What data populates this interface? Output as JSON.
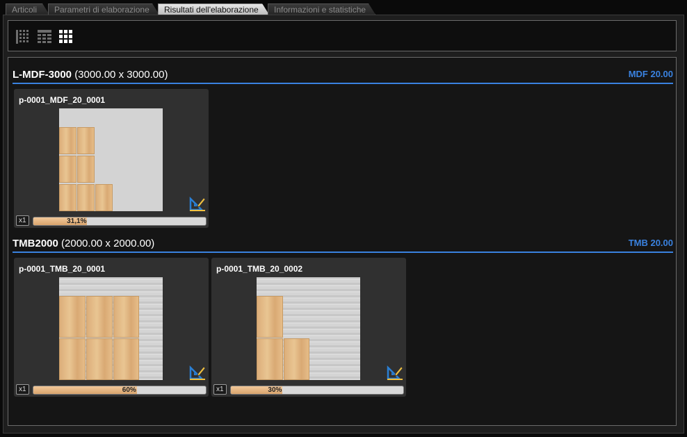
{
  "tabs": [
    {
      "label": "Articoli",
      "active": false
    },
    {
      "label": "Parametri di elaborazione",
      "active": false
    },
    {
      "label": "Risultati dell'elaborazione",
      "active": true
    },
    {
      "label": "Informazioni e statistiche",
      "active": false
    }
  ],
  "toolbar": {
    "views": [
      "list-view-icon",
      "table-view-icon",
      "grid-view-icon"
    ],
    "active_view": "grid-view-icon"
  },
  "groups": [
    {
      "name": "L-MDF-3000",
      "size": "(3000.00 x 3000.00)",
      "material": "MDF 20.00",
      "cards": [
        {
          "title": "p-0001_MDF_20_0001",
          "qty": "x1",
          "percent_label": "31,1%",
          "fill": 0.311,
          "texture": "plain"
        }
      ]
    },
    {
      "name": "TMB2000",
      "size": "(2000.00 x 2000.00)",
      "material": "TMB 20.00",
      "cards": [
        {
          "title": "p-0001_TMB_20_0001",
          "qty": "x1",
          "percent_label": "60%",
          "fill": 0.6,
          "texture": "wood"
        },
        {
          "title": "p-0001_TMB_20_0002",
          "qty": "x1",
          "percent_label": "30%",
          "fill": 0.3,
          "texture": "wood"
        }
      ]
    }
  ],
  "colors": {
    "accent": "#3a82e0",
    "piece": "#e2b884",
    "sheet": "#d3d3d3"
  }
}
